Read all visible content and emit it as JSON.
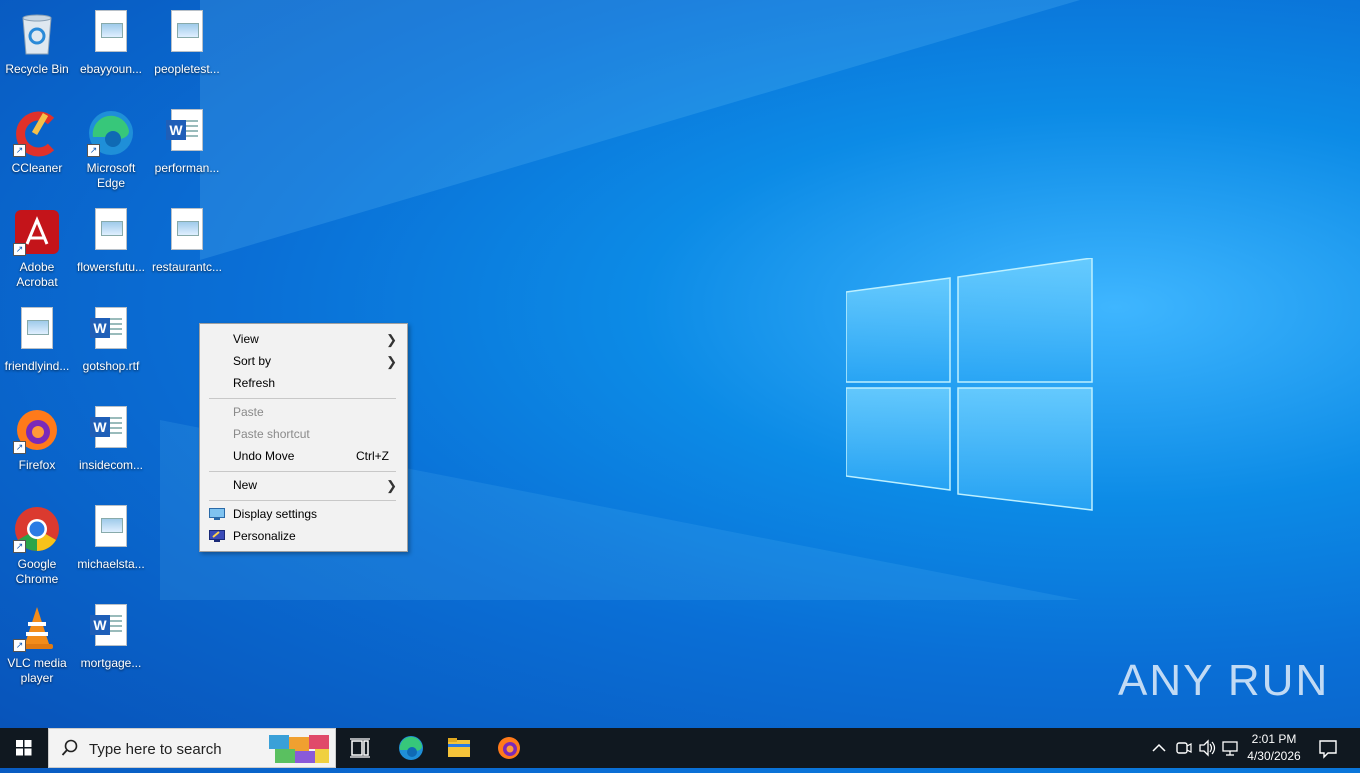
{
  "desktop": {
    "icons": [
      {
        "label": "Recycle Bin"
      },
      {
        "label": "ebayyoun..."
      },
      {
        "label": "peopletest..."
      },
      {
        "label": "CCleaner"
      },
      {
        "label": "Microsoft Edge"
      },
      {
        "label": "performan..."
      },
      {
        "label": "Adobe Acrobat"
      },
      {
        "label": "flowersfutu..."
      },
      {
        "label": "restaurantc..."
      },
      {
        "label": "friendlyind..."
      },
      {
        "label": "gotshop.rtf"
      },
      {
        "label": "Firefox"
      },
      {
        "label": "insidecom..."
      },
      {
        "label": "Google Chrome"
      },
      {
        "label": "michaelsta..."
      },
      {
        "label": "VLC media player"
      },
      {
        "label": "mortgage..."
      }
    ]
  },
  "context_menu": {
    "view": "View",
    "sort_by": "Sort by",
    "refresh": "Refresh",
    "paste": "Paste",
    "paste_shortcut": "Paste shortcut",
    "undo_move": "Undo Move",
    "undo_shortcut": "Ctrl+Z",
    "new": "New",
    "display_settings": "Display settings",
    "personalize": "Personalize"
  },
  "taskbar": {
    "search_placeholder": "Type here to search",
    "time": "2:01 PM",
    "date": "4/30/2026"
  },
  "watermark": "ANY RUN"
}
